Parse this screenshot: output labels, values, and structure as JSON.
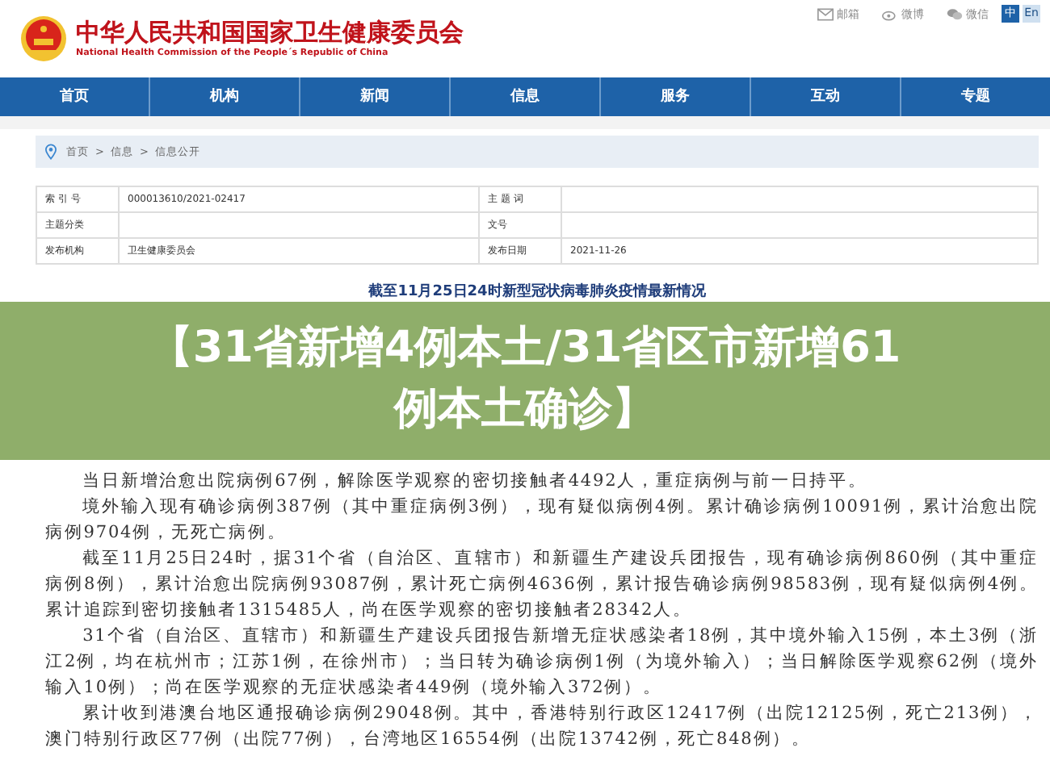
{
  "header": {
    "title": "中华人民共和国国家卫生健康委员会",
    "subtitle": "National Health Commission of the People´s Republic of China",
    "links": [
      {
        "kind": "mail",
        "label": "邮箱"
      },
      {
        "kind": "weibo",
        "label": "微博"
      },
      {
        "kind": "wechat",
        "label": "微信"
      }
    ],
    "languages": [
      {
        "label": "中",
        "selected": true
      },
      {
        "label": "En",
        "selected": false
      }
    ]
  },
  "nav": [
    {
      "label": "首页"
    },
    {
      "label": "机构"
    },
    {
      "label": "新闻"
    },
    {
      "label": "信息"
    },
    {
      "label": "服务"
    },
    {
      "label": "互动"
    },
    {
      "label": "专题"
    }
  ],
  "breadcrumb": {
    "separator": ">",
    "items": [
      "首页",
      "信息",
      "信息公开"
    ]
  },
  "meta_table": {
    "rows": [
      [
        {
          "label": "索 引 号",
          "value": "000013610/2021-02417"
        },
        {
          "label": "主 题 词"
        }
      ],
      [
        {
          "label": "主题分类"
        },
        {
          "label": "文号"
        }
      ],
      [
        {
          "label": "发布机构",
          "value": "卫生健康委员会"
        },
        {
          "label": "发布日期",
          "value": "2021-11-26"
        }
      ]
    ]
  },
  "article": {
    "title": "截至11月25日24时新型冠状病毒肺炎疫情最新情况",
    "paragraphs": [
      "当日新增治愈出院病例67例，解除医学观察的密切接触者4492人，重症病例与前一日持平。",
      "境外输入现有确诊病例387例（其中重症病例3例），现有疑似病例4例。累计确诊病例10091例，累计治愈出院病例9704例，无死亡病例。",
      "截至11月25日24时，据31个省（自治区、直辖市）和新疆生产建设兵团报告，现有确诊病例860例（其中重症病例8例），累计治愈出院病例93087例，累计死亡病例4636例，累计报告确诊病例98583例，现有疑似病例4例。累计追踪到密切接触者1315485人，尚在医学观察的密切接触者28342人。",
      "31个省（自治区、直辖市）和新疆生产建设兵团报告新增无症状感染者18例，其中境外输入15例，本土3例（浙江2例，均在杭州市；江苏1例，在徐州市）；当日转为确诊病例1例（为境外输入）；当日解除医学观察62例（境外输入10例）；尚在医学观察的无症状感染者449例（境外输入372例）。",
      "累计收到港澳台地区通报确诊病例29048例。其中，香港特别行政区12417例（出院12125例，死亡213例），澳门特别行政区77例（出院77例），台湾地区16554例（出院13742例，死亡848例）。"
    ]
  },
  "banner": {
    "text": "【31省新增4例本土/31省区市新增61例本土确诊】"
  }
}
